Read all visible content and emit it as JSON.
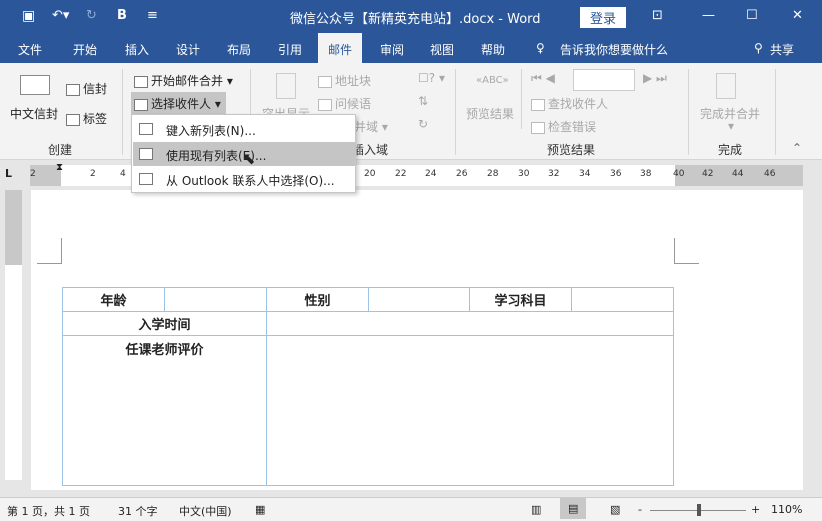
{
  "titlebar": {
    "title": "微信公众号【新精英充电站】.docx - Word",
    "login": "登录",
    "save_icon": "save-icon",
    "undo_icon": "undo-icon",
    "redo_icon": "redo-icon",
    "bold": "B"
  },
  "tabs": [
    "文件",
    "开始",
    "插入",
    "设计",
    "布局",
    "引用",
    "邮件",
    "审阅",
    "视图",
    "帮助"
  ],
  "tell_me": "告诉我你想要做什么",
  "share": "共享",
  "ribbon": {
    "create": {
      "envelope_big": "中文信封",
      "envelope": "信封",
      "labels": "标签",
      "group": "创建"
    },
    "start": {
      "start_merge": "开始邮件合并",
      "select_recipients": "选择收件人",
      "group": "开始邮件合并"
    },
    "write": {
      "highlight": "突出显示",
      "address_block": "地址块",
      "greeting": "问候语",
      "insert_field": "插入合并域",
      "group": "编写和插入域"
    },
    "preview": {
      "preview_results": "预览结果",
      "find_recipient": "查找收件人",
      "check_errors": "检查错误",
      "record": "",
      "group": "预览结果"
    },
    "finish": {
      "finish_merge": "完成并合并",
      "group": "完成"
    }
  },
  "menu": [
    "键入新列表(N)...",
    "使用现有列表(E)...",
    "从 Outlook 联系人中选择(O)..."
  ],
  "ruler": {
    "numbers": [
      "2",
      "2",
      "4",
      "20",
      "22",
      "24",
      "26",
      "28",
      "30",
      "32",
      "34",
      "36",
      "38",
      "40",
      "42",
      "44",
      "46"
    ]
  },
  "table": {
    "row1": [
      "年龄",
      "",
      "性别",
      "",
      "学习科目",
      ""
    ],
    "row2": [
      "入学时间",
      ""
    ],
    "row3": [
      "任课老师评价",
      ""
    ]
  },
  "status": {
    "page": "第 1 页，共 1 页",
    "words": "31 个字",
    "lang": "中文(中国)",
    "zoom": "110%"
  }
}
